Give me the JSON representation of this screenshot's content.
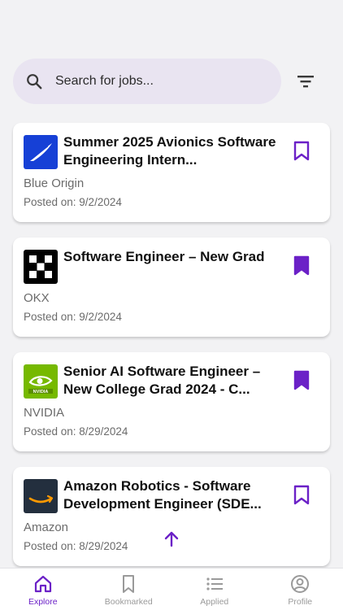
{
  "colors": {
    "accent": "#6b21c7",
    "search_bg": "#e9e4f1",
    "muted_text": "#6b6b6b",
    "inactive_tab": "#9a9a9a"
  },
  "search": {
    "placeholder": "Search for jobs...",
    "search_icon": "search-icon",
    "filter_icon": "filter-icon"
  },
  "jobs": [
    {
      "title": "Summer 2025 Avionics Software Engineering Intern...",
      "company": "Blue Origin",
      "posted": "Posted on: 9/2/2024",
      "logo_icon": "blue-origin-logo",
      "bookmarked": false
    },
    {
      "title": "Software Engineer – New Grad",
      "company": "OKX",
      "posted": "Posted on: 9/2/2024",
      "logo_icon": "okx-logo",
      "bookmarked": true
    },
    {
      "title": "Senior AI Software Engineer – New College Grad 2024 - C...",
      "company": "NVIDIA",
      "posted": "Posted on: 8/29/2024",
      "logo_icon": "nvidia-logo",
      "bookmarked": true
    },
    {
      "title": "Amazon Robotics - Software Development Engineer (SDE...",
      "company": "Amazon",
      "posted": "Posted on: 8/29/2024",
      "logo_icon": "amazon-logo",
      "bookmarked": false
    }
  ],
  "scroll_top_icon": "arrow-up-icon",
  "tabs": [
    {
      "label": "Explore",
      "icon": "home-icon",
      "active": true
    },
    {
      "label": "Bookmarked",
      "icon": "bookmark-icon",
      "active": false
    },
    {
      "label": "Applied",
      "icon": "list-icon",
      "active": false
    },
    {
      "label": "Profile",
      "icon": "profile-icon",
      "active": false
    }
  ]
}
